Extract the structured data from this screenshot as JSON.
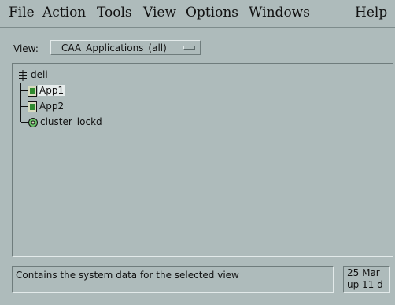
{
  "menubar": {
    "file": "File",
    "action": "Action",
    "tools": "Tools",
    "view": "View",
    "options": "Options",
    "windows": "Windows",
    "help": "Help"
  },
  "view_selector": {
    "label": "View:",
    "selected": "CAA_Applications_(all)"
  },
  "tree": {
    "root": {
      "label": "deli",
      "icon": "cluster-icon"
    },
    "children": [
      {
        "label": "App1",
        "icon": "app-resource-icon",
        "selected": true
      },
      {
        "label": "App2",
        "icon": "app-resource-icon",
        "selected": false
      },
      {
        "label": "cluster_lockd",
        "icon": "lock-resource-icon",
        "selected": false
      }
    ]
  },
  "status": {
    "message": "Contains the system data for the selected view",
    "date": "25 Mar",
    "uptime": "up 11 d"
  },
  "colors": {
    "background": "#aebbbb",
    "selection": "#e6ecec",
    "app_icon": "#2e8b2e"
  }
}
